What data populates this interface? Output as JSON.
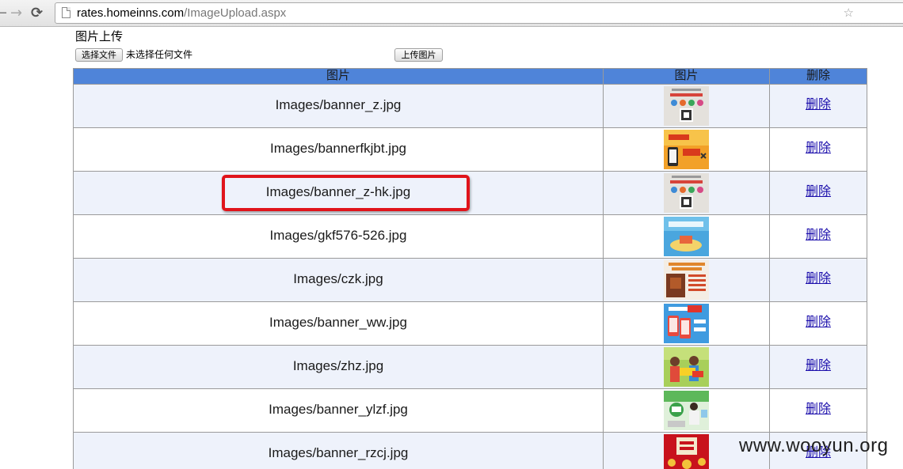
{
  "browser": {
    "url_host": "rates.homeinns.com",
    "url_path": "/ImageUpload.aspx"
  },
  "page": {
    "title": "图片上传",
    "choose_file_label": "选择文件",
    "file_status": "未选择任何文件",
    "upload_label": "上传图片"
  },
  "table": {
    "headers": [
      "图片",
      "图片",
      "删除"
    ],
    "rows": [
      {
        "path": "Images/banner_z.jpg",
        "action": "删除",
        "thumb": "banner-thumb-qr"
      },
      {
        "path": "Images/bannerfkjbt.jpg",
        "action": "删除",
        "thumb": "banner-thumb-orange"
      },
      {
        "path": "Images/banner_z-hk.jpg",
        "action": "删除",
        "thumb": "banner-thumb-qr"
      },
      {
        "path": "Images/gkf576-526.jpg",
        "action": "删除",
        "thumb": "banner-thumb-blue"
      },
      {
        "path": "Images/czk.jpg",
        "action": "删除",
        "thumb": "banner-thumb-card"
      },
      {
        "path": "Images/banner_ww.jpg",
        "action": "删除",
        "thumb": "banner-thumb-phones"
      },
      {
        "path": "Images/zhz.jpg",
        "action": "删除",
        "thumb": "banner-thumb-green"
      },
      {
        "path": "Images/banner_ylzf.jpg",
        "action": "删除",
        "thumb": "banner-thumb-pay"
      },
      {
        "path": "Images/banner_rzcj.jpg",
        "action": "删除",
        "thumb": "banner-thumb-red"
      }
    ]
  },
  "colors": {
    "header_bg": "#4f84d9",
    "highlight": "#e0141b",
    "link": "#1a0dab"
  },
  "watermark": "www.wooyun.org"
}
